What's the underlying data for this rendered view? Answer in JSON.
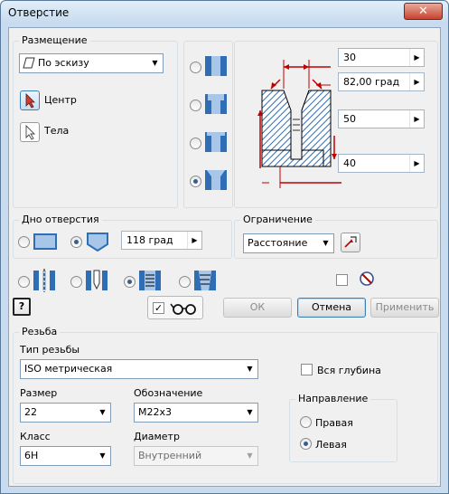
{
  "window": {
    "title": "Отверстие",
    "close_glyph": "✕"
  },
  "placement": {
    "group_label": "Размещение",
    "mode_value": "По эскизу",
    "center_label": "Центр",
    "solids_label": "Тела"
  },
  "hole_type": {
    "options": [
      "simple",
      "counterbore",
      "spotface",
      "countersink"
    ],
    "selected_index": 3
  },
  "preview_params": {
    "p1": "30",
    "p2": "82,00 град",
    "p3": "50",
    "p4": "40"
  },
  "bottom": {
    "group_label": "Дно отверстия",
    "options": [
      "flat",
      "angle"
    ],
    "selected": "angle",
    "angle_value": "118 град"
  },
  "termination": {
    "group_label": "Ограничение",
    "value": "Расстояние"
  },
  "hole_kind": {
    "options": [
      "drilled",
      "clearance",
      "tapped",
      "taper-tapped"
    ],
    "selected": "tapped"
  },
  "extras": {
    "check_state": "unchecked",
    "preview_toggle_check": "✓"
  },
  "buttons": {
    "ok": "ОК",
    "cancel": "Отмена",
    "apply": "Применить",
    "help": "?"
  },
  "thread": {
    "group_label": "Резьба",
    "type_label": "Тип резьбы",
    "type_value": "ISO метрическая",
    "full_depth_label": "Вся глубина",
    "size_label": "Размер",
    "size_value": "22",
    "designation_label": "Обозначение",
    "designation_value": "M22x3",
    "class_label": "Класс",
    "class_value": "6H",
    "diameter_label": "Диаметр",
    "diameter_value": "Внутренний",
    "direction": {
      "group_label": "Направление",
      "right_label": "Правая",
      "left_label": "Левая",
      "selected": "left"
    }
  },
  "colors": {
    "dim_red": "#c00000",
    "hatch_blue": "#2f6db5",
    "hole_fill": "#a8c6e8"
  }
}
